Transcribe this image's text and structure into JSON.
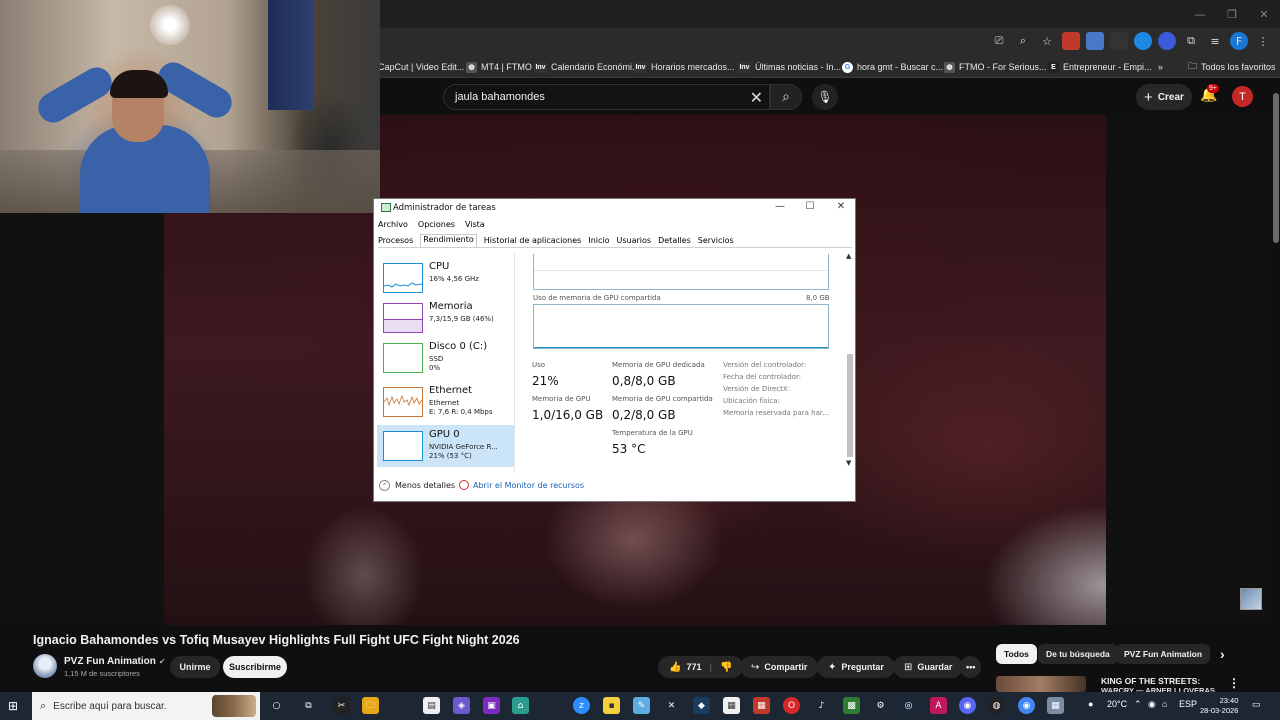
{
  "browser": {
    "window_controls": [
      "—",
      "❐",
      "✕"
    ],
    "bookmarks": [
      {
        "label": "CapCut | Video Edit...",
        "icon": "capcut-icon",
        "glyph": "",
        "color": "#444444"
      },
      {
        "label": "MT4 | FTMO",
        "icon": "globe-icon",
        "glyph": "◍",
        "color": "#555555"
      },
      {
        "label": "Calendario Económi...",
        "icon": "investing-icon",
        "glyph": "Inv",
        "color": "#333333"
      },
      {
        "label": "Horarios mercados...",
        "icon": "investing-icon",
        "glyph": "Inv",
        "color": "#333333"
      },
      {
        "label": "Últimas noticias - In...",
        "icon": "investing-icon",
        "glyph": "Inv",
        "color": "#333333"
      },
      {
        "label": "hora gmt - Buscar c...",
        "icon": "google-icon",
        "glyph": "G",
        "color": "#4285f4"
      },
      {
        "label": "FTMO - For Serious...",
        "icon": "ftmo-icon",
        "glyph": "◍",
        "color": "#555555"
      },
      {
        "label": "Entrepreneur - Empi...",
        "icon": "entrepreneur-icon",
        "glyph": "E",
        "color": "#222222"
      }
    ],
    "bookmarks_more": "»",
    "all_bookmarks": "Todos los favoritos"
  },
  "youtube": {
    "search_value": "jaula bahamondes",
    "create_label": "Crear",
    "notifications_badge": "9+",
    "avatar_letter": "T",
    "video_title": "Ignacio Bahamondes vs Tofiq Musayev Highlights Full Fight UFC Fight Night 2026",
    "channel_name": "PVZ Fun Animation",
    "subscribers": "1,15 M de suscriptores",
    "join_label": "Unirme",
    "subscribe_label": "Suscribirme",
    "likes": "771",
    "share_label": "Compartir",
    "ask_label": "Preguntar",
    "save_label": "Guardar",
    "more_label": "•••",
    "chips": [
      "Todos",
      "De tu búsqueda",
      "PVZ Fun Animation"
    ],
    "chip_next": "›",
    "recommended_title": "KING OF THE STREETS:",
    "recommended_sub": "WARCRY — ARNER LLOVERAS",
    "recommended_more": "⋮"
  },
  "task_manager": {
    "title": "Administrador de tareas",
    "controls": [
      "—",
      "☐",
      "✕"
    ],
    "menu": [
      "Archivo",
      "Opciones",
      "Vista"
    ],
    "tabs": [
      "Procesos",
      "Rendimiento",
      "Historial de aplicaciones",
      "Inicio",
      "Usuarios",
      "Detalles",
      "Servicios"
    ],
    "active_tab": "Rendimiento",
    "resources": [
      {
        "name": "CPU",
        "line1": "16% 4,56 GHz",
        "line2": "",
        "color": "#1a8fd1"
      },
      {
        "name": "Memoria",
        "line1": "7,3/15,9 GB (46%)",
        "line2": "",
        "color": "#8e44ad"
      },
      {
        "name": "Disco 0 (C:)",
        "line1": "SSD",
        "line2": "0%",
        "color": "#4caf50"
      },
      {
        "name": "Ethernet",
        "line1": "Ethernet",
        "line2": "E: 7,6 R: 0,4 Mbps",
        "color": "#c87533"
      },
      {
        "name": "GPU 0",
        "line1": "NVIDIA GeForce R...",
        "line2": "21% (53 °C)",
        "color": "#1a8fd1"
      }
    ],
    "shared_memory_label": "Uso de memoria de GPU compartida",
    "shared_memory_max": "8,0 GB",
    "stats": {
      "uso_label": "Uso",
      "uso_value": "21%",
      "dedicated_label": "Memoria de GPU dedicada",
      "dedicated_value": "0,8/8,0 GB",
      "gpu_mem_label": "Memoria de GPU",
      "gpu_mem_value": "1,0/16,0 GB",
      "shared_label": "Memoria de GPU compartida",
      "shared_value": "0,2/8,0 GB",
      "temp_label": "Temperatura de la GPU",
      "temp_value": "53 °C"
    },
    "details": [
      "Versión del controlador:",
      "Fecha del controlador:",
      "Versión de DirectX:",
      "Ubicación física:",
      "Memoria reservada para har..."
    ],
    "less_details": "Menos detalles",
    "resource_monitor": "Abrir el Monitor de recursos"
  },
  "taskbar": {
    "search_placeholder": "Escribe aquí para buscar.",
    "temperature": "20°C",
    "language": "ESP",
    "time": "23:40",
    "date": "28-03-2026"
  }
}
